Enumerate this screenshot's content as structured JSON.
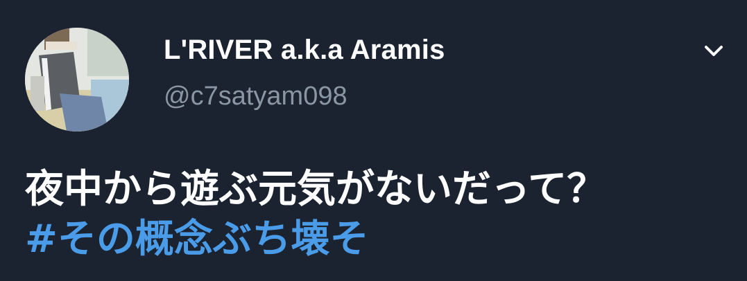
{
  "user": {
    "display_name": "L'RIVER a.k.a Aramis",
    "handle": "@c7satyam098",
    "avatar": "profile-photo"
  },
  "menu": {
    "icon": "chevron-down-icon"
  },
  "tweet": {
    "text": "夜中から遊ぶ元気がないだって？",
    "hashtag": "#その概念ぶち壊そ"
  },
  "colors": {
    "background": "#1c2330",
    "text": "#ffffff",
    "handle": "#8a96a3",
    "hashtag": "#4a9ce8"
  }
}
